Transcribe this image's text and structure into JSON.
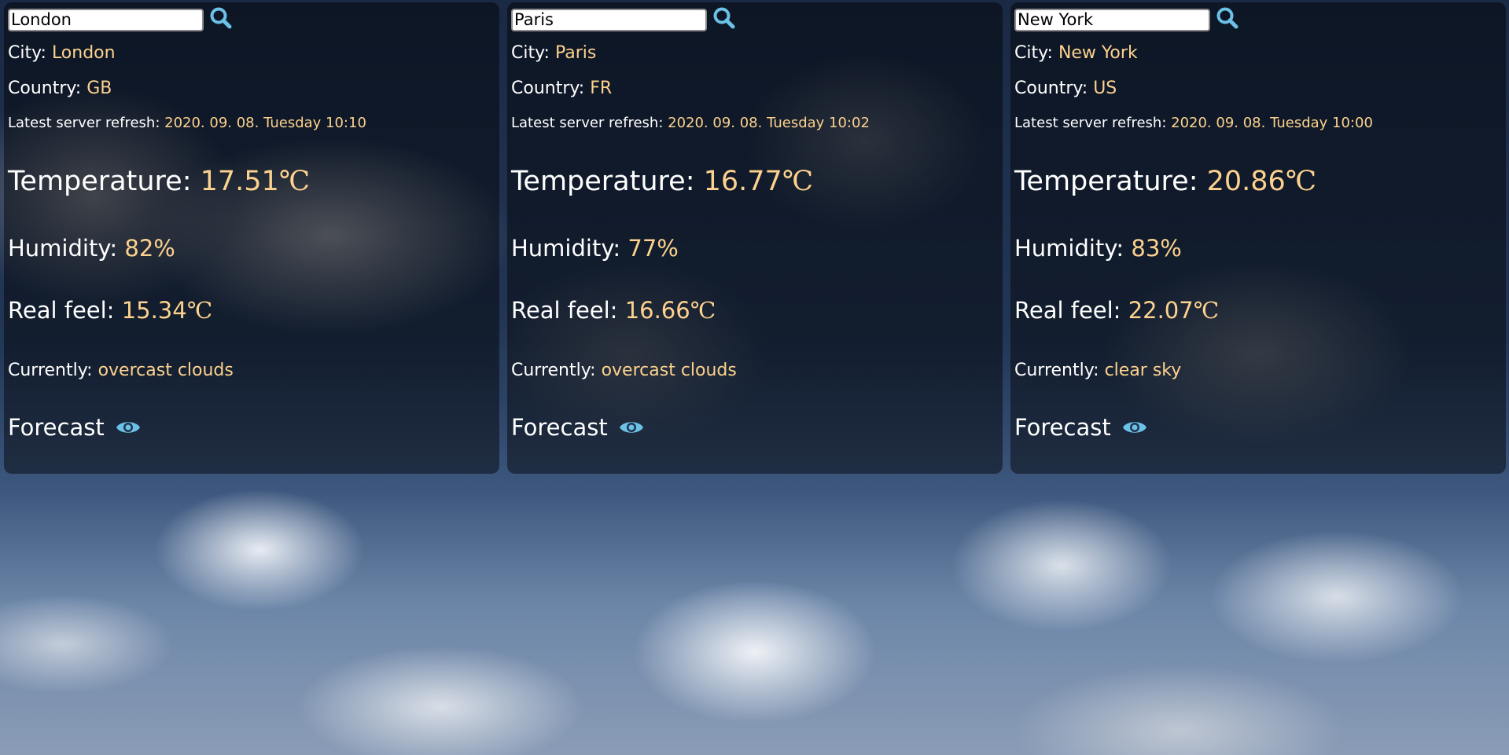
{
  "labels": {
    "city": "City: ",
    "country": "Country: ",
    "refresh": "Latest server refresh: ",
    "temperature": "Temperature: ",
    "humidity": "Humidity: ",
    "real_feel": "Real feel: ",
    "currently": "Currently: ",
    "forecast": "Forecast",
    "unit": "℃"
  },
  "colors": {
    "accent": "#fdd28e",
    "icon": "#6cc1e6"
  },
  "icons": {
    "search": "search-icon",
    "forecast": "eye-icon"
  },
  "cards": [
    {
      "search_value": "London",
      "city": "London",
      "country": "GB",
      "refresh": "2020. 09. 08. Tuesday 10:10",
      "temperature": "17.51",
      "humidity": "82%",
      "real_feel": "15.34",
      "currently": "overcast clouds"
    },
    {
      "search_value": "Paris",
      "city": "Paris",
      "country": "FR",
      "refresh": "2020. 09. 08. Tuesday 10:02",
      "temperature": "16.77",
      "humidity": "77%",
      "real_feel": "16.66",
      "currently": "overcast clouds"
    },
    {
      "search_value": "New York",
      "city": "New York",
      "country": "US",
      "refresh": "2020. 09. 08. Tuesday 10:00",
      "temperature": "20.86",
      "humidity": "83%",
      "real_feel": "22.07",
      "currently": "clear sky"
    }
  ]
}
